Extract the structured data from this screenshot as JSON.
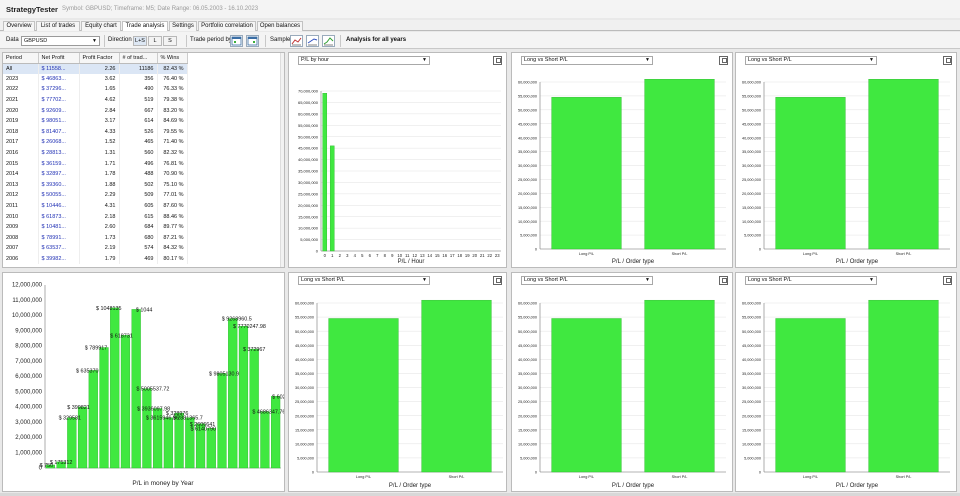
{
  "app": {
    "title": "StrategyTester",
    "subtitle": "Symbol: GBPUSD; Timeframe: M5; Date Range: 06.05.2003 - 16.10.2023"
  },
  "tabs": [
    "Overview",
    "List of trades",
    "Equity chart",
    "Trade analysis",
    "Settings",
    "Portfolio correlation",
    "Open balances"
  ],
  "active_tab": "Trade analysis",
  "toolbar": {
    "data_label": "Data",
    "data_value": "GBPUSD",
    "direction_label": "Direction",
    "direction_options": [
      "L+S",
      "L",
      "S"
    ],
    "trade_period_label": "Trade period by",
    "sample_label": "Sample",
    "analysis_title": "Analysis for all years"
  },
  "table": {
    "headers": [
      "Period",
      "Net Profit",
      "Profit Factor",
      "# of trad...",
      "% Wins"
    ],
    "rows": [
      [
        "All",
        "$ 11558...",
        "2.26",
        "11186",
        "82.43 %"
      ],
      [
        "2023",
        "$ 46863...",
        "3.62",
        "356",
        "76.40 %"
      ],
      [
        "2022",
        "$ 37296...",
        "1.65",
        "490",
        "76.33 %"
      ],
      [
        "2021",
        "$ 77702...",
        "4.62",
        "519",
        "79.38 %"
      ],
      [
        "2020",
        "$ 92609...",
        "2.84",
        "667",
        "83.20 %"
      ],
      [
        "2019",
        "$ 98051...",
        "3.17",
        "614",
        "84.69 %"
      ],
      [
        "2018",
        "$ 81407...",
        "4.33",
        "526",
        "79.55 %"
      ],
      [
        "2017",
        "$ 26068...",
        "1.52",
        "465",
        "71.40 %"
      ],
      [
        "2016",
        "$ 28813...",
        "1.31",
        "560",
        "82.32 %"
      ],
      [
        "2015",
        "$ 36159...",
        "1.71",
        "496",
        "76.81 %"
      ],
      [
        "2014",
        "$ 32897...",
        "1.78",
        "488",
        "70.90 %"
      ],
      [
        "2013",
        "$ 39360...",
        "1.88",
        "502",
        "75.10 %"
      ],
      [
        "2012",
        "$ 50055...",
        "2.29",
        "509",
        "77.01 %"
      ],
      [
        "2011",
        "$ 10446...",
        "4.31",
        "605",
        "87.60 %"
      ],
      [
        "2010",
        "$ 61873...",
        "2.18",
        "615",
        "88.46 %"
      ],
      [
        "2009",
        "$ 10481...",
        "2.60",
        "684",
        "89.77 %"
      ],
      [
        "2008",
        "$ 78991...",
        "1.73",
        "680",
        "87.21 %"
      ],
      [
        "2007",
        "$ 63537...",
        "2.19",
        "574",
        "84.32 %"
      ],
      [
        "2006",
        "$ 39982...",
        "1.79",
        "469",
        "80.17 %"
      ]
    ]
  },
  "panels": {
    "hour": {
      "selector": "P/L by hour"
    },
    "top_middle": {
      "selector": "Long vs Short P/L"
    },
    "top_right": {
      "selector": "Long vs Short P/L"
    },
    "bottom_left": {
      "selector": "Long vs Short P/L"
    },
    "bottom_middle": {
      "selector": "Long vs Short P/L"
    },
    "bottom_right": {
      "selector": "Long vs Short P/L"
    }
  },
  "colors": {
    "bar": "#40e840",
    "bar_stroke": "#2ab52a",
    "link_blue": "#1f2fb4"
  },
  "chart_data": [
    {
      "id": "pl_by_year",
      "type": "bar",
      "xlabel": "P/L in money by Year",
      "ylim": [
        0,
        12000000
      ],
      "yticks": [
        "0",
        "1,000,000",
        "2,000,000",
        "3,000,000",
        "4,000,000",
        "5,000,000",
        "6,000,000",
        "7,000,000",
        "8,000,000",
        "9,000,000",
        "10,000,000",
        "11,000,000",
        "12,000,000"
      ],
      "values": [
        200000,
        400000,
        3300000,
        4000000,
        6400000,
        7900000,
        10500000,
        8700000,
        10400000,
        5200000,
        3900000,
        3300000,
        3600000,
        3300000,
        2900000,
        2600000,
        6200000,
        9800000,
        9300000,
        7800000,
        3700000,
        4700000
      ],
      "labels": [
        "$ 750",
        "$ 175312",
        "$ 329581",
        "$ 399821",
        "$ 635370",
        "$ 789917",
        "$ 1048135",
        "$ 618731",
        "$ 1044",
        "$ 5005537.72",
        "$ 3936097.98",
        "$ 3615946.96",
        "$ 328976",
        "$ 2881365.7",
        "$ 2606641",
        "$ 6140790",
        "$ 9805130.9",
        "$ 9268960.5",
        "$ 7770247.98",
        "$ 372967",
        "$ 4686347.76",
        "$ 60222.54"
      ]
    },
    {
      "id": "pl_by_hour",
      "type": "bar",
      "xlabel": "P/L / Hour",
      "ylim": [
        0,
        70000000
      ],
      "yticks": [
        "0",
        "5,000,000",
        "10,000,000",
        "15,000,000",
        "20,000,000",
        "25,000,000",
        "30,000,000",
        "35,000,000",
        "40,000,000",
        "45,000,000",
        "50,000,000",
        "55,000,000",
        "60,000,000",
        "65,000,000",
        "70,000,000"
      ],
      "categories": [
        "0",
        "1",
        "2",
        "3",
        "4",
        "5",
        "6",
        "7",
        "8",
        "9",
        "10",
        "11",
        "12",
        "13",
        "14",
        "15",
        "16",
        "17",
        "18",
        "19",
        "20",
        "21",
        "22",
        "23"
      ],
      "values": [
        69000000,
        46000000,
        0,
        0,
        0,
        0,
        0,
        0,
        0,
        0,
        0,
        0,
        0,
        0,
        0,
        0,
        0,
        0,
        0,
        0,
        0,
        0,
        0,
        0
      ]
    },
    {
      "id": "long_vs_short_1",
      "type": "bar",
      "xlabel": "P/L / Order type",
      "ylim": [
        0,
        60000000
      ],
      "yticks": [
        "0",
        "5,000,000",
        "10,000,000",
        "15,000,000",
        "20,000,000",
        "25,000,000",
        "30,000,000",
        "35,000,000",
        "40,000,000",
        "45,000,000",
        "50,000,000",
        "55,000,000",
        "60,000,000"
      ],
      "categories": [
        "Long P/L",
        "Short P/L"
      ],
      "values": [
        54500000,
        61000000
      ]
    },
    {
      "id": "long_vs_short_2",
      "type": "bar",
      "xlabel": "P/L / Order type",
      "ylim": [
        0,
        60000000
      ],
      "yticks": [
        "0",
        "5,000,000",
        "10,000,000",
        "15,000,000",
        "20,000,000",
        "25,000,000",
        "30,000,000",
        "35,000,000",
        "40,000,000",
        "45,000,000",
        "50,000,000",
        "55,000,000",
        "60,000,000"
      ],
      "categories": [
        "Long P/L",
        "Short P/L"
      ],
      "values": [
        54500000,
        61000000
      ]
    },
    {
      "id": "long_vs_short_3",
      "type": "bar",
      "xlabel": "P/L / Order type",
      "ylim": [
        0,
        60000000
      ],
      "yticks": [
        "0",
        "5,000,000",
        "10,000,000",
        "15,000,000",
        "20,000,000",
        "25,000,000",
        "30,000,000",
        "35,000,000",
        "40,000,000",
        "45,000,000",
        "50,000,000",
        "55,000,000",
        "60,000,000"
      ],
      "categories": [
        "Long P/L",
        "Short P/L"
      ],
      "values": [
        54500000,
        61000000
      ]
    },
    {
      "id": "long_vs_short_4",
      "type": "bar",
      "xlabel": "P/L / Order type",
      "ylim": [
        0,
        60000000
      ],
      "yticks": [
        "0",
        "5,000,000",
        "10,000,000",
        "15,000,000",
        "20,000,000",
        "25,000,000",
        "30,000,000",
        "35,000,000",
        "40,000,000",
        "45,000,000",
        "50,000,000",
        "55,000,000",
        "60,000,000"
      ],
      "categories": [
        "Long P/L",
        "Short P/L"
      ],
      "values": [
        54500000,
        61000000
      ]
    },
    {
      "id": "long_vs_short_5",
      "type": "bar",
      "xlabel": "P/L / Order type",
      "ylim": [
        0,
        60000000
      ],
      "yticks": [
        "0",
        "5,000,000",
        "10,000,000",
        "15,000,000",
        "20,000,000",
        "25,000,000",
        "30,000,000",
        "35,000,000",
        "40,000,000",
        "45,000,000",
        "50,000,000",
        "55,000,000",
        "60,000,000"
      ],
      "categories": [
        "Long P/L",
        "Short P/L"
      ],
      "values": [
        54500000,
        61000000
      ]
    }
  ]
}
